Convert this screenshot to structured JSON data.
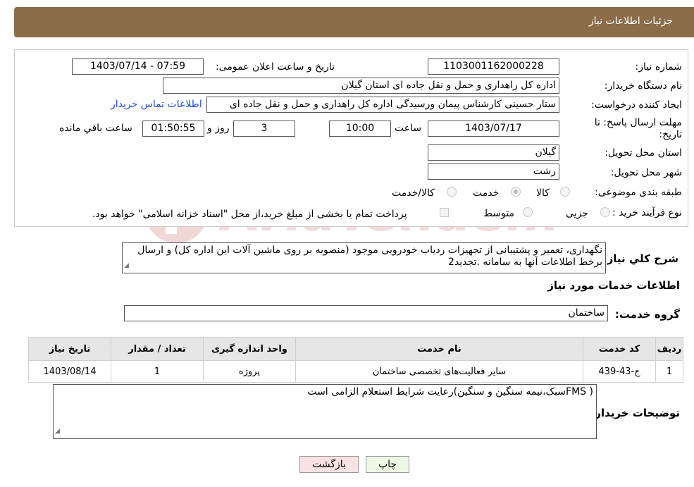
{
  "header": {
    "title": "جزئیات اطلاعات نیاز"
  },
  "form": {
    "need_number": {
      "label": "شماره نیاز:",
      "value": "1103001162000228"
    },
    "announce_datetime": {
      "label": "تاریخ و ساعت اعلان عمومی:",
      "value": "1403/07/14 - 07:59"
    },
    "buyer_org": {
      "label": "نام دستگاه خریدار:",
      "value": "اداره کل راهداری و حمل و نقل جاده ای استان گیلان"
    },
    "requester": {
      "label": "ایجاد کننده درخواست:",
      "value": "ستار حسینی کارشناس پیمان ورسیدگی اداره کل راهداری و حمل و نقل جاده ای",
      "contact_link": "اطلاعات تماس خریدار"
    },
    "deadline": {
      "label_line1": "مهلت ارسال پاسخ: تا",
      "label_line2": "تاریخ:",
      "date": "1403/07/17",
      "time_label": "ساعت",
      "time": "10:00",
      "days": "3",
      "days_label": "روز و",
      "remaining": "01:50:55",
      "remaining_label": "ساعت باقي مانده"
    },
    "province": {
      "label": "استان محل تحویل:",
      "value": "گیلان"
    },
    "city": {
      "label": "شهر محل تحویل:",
      "value": "رشت"
    },
    "category": {
      "label": "طبقه بندی موضوعی:",
      "options": [
        {
          "label": "کالا",
          "checked": false
        },
        {
          "label": "خدمت",
          "checked": true
        },
        {
          "label": "کالا/خدمت",
          "checked": false
        }
      ]
    },
    "purchase_type": {
      "label": "نوع فرآیند خرید :",
      "options": [
        {
          "label": "جزیی",
          "checked": false
        },
        {
          "label": "متوسط",
          "checked": false
        }
      ],
      "payment_note": "پرداخت تمام یا بخشی از مبلغ خرید،از محل \"اسناد خزانه اسلامی\" خواهد بود.",
      "payment_checked": false
    }
  },
  "description": {
    "label": "شرح کلي نیاز:",
    "value": "نگهداری، تعمیر و پشتیبانی از تجهیزات ردیاب خودرویی موجود (منصوبه بر روی ماشین آلات این اداره کل) و ارسال برخط اطلاعات آنها به سامانه .تجدید2"
  },
  "services_section": {
    "title": "اطلاعات خدمات مورد نیاز",
    "group_label": "گروه خدمت:",
    "group_value": "ساختمان",
    "table": {
      "headers": [
        "ردیف",
        "کد خدمت",
        "نام خدمت",
        "واحد اندازه گیری",
        "تعداد / مقدار",
        "تاریخ نیاز"
      ],
      "rows": [
        [
          "1",
          "ج-43-439",
          "سایر فعالیت‌های تخصصی ساختمان",
          "پروژه",
          "1",
          "1403/08/14"
        ]
      ]
    }
  },
  "buyer_notes": {
    "label": "توضیحات خریدار:",
    "value": "( FMSسبک،نیمه سنگین و سنگین)رعایت شرایط استعلام الزامی است"
  },
  "buttons": {
    "print": "چاپ",
    "back": "بازگشت"
  },
  "watermark": {
    "text": "AriaTender.net",
    "color": "#e3b9b9"
  }
}
